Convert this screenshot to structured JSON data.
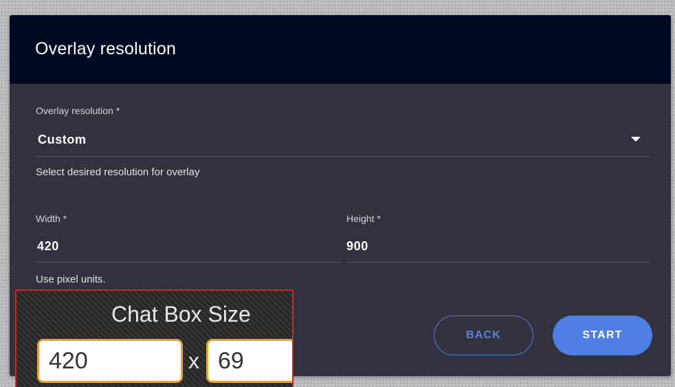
{
  "dialog": {
    "title": "Overlay resolution",
    "resolution": {
      "label": "Overlay resolution *",
      "value": "Custom",
      "helper": "Select desired resolution for overlay"
    },
    "width": {
      "label": "Width *",
      "value": "420"
    },
    "height": {
      "label": "Height *",
      "value": "900"
    },
    "units_helper": "Use pixel units.",
    "buttons": {
      "back": "BACK",
      "start": "START"
    }
  },
  "chat_box": {
    "title": "Chat Box Size",
    "width": "420",
    "separator": "x",
    "height": "69"
  },
  "colors": {
    "header_bg": "#020a22",
    "dialog_bg": "#32323f",
    "accent": "#4f7fe3",
    "chat_border": "#d0262a",
    "chat_input_border": "#e9a233"
  },
  "icons": {
    "dropdown": "triangle-down-icon"
  }
}
